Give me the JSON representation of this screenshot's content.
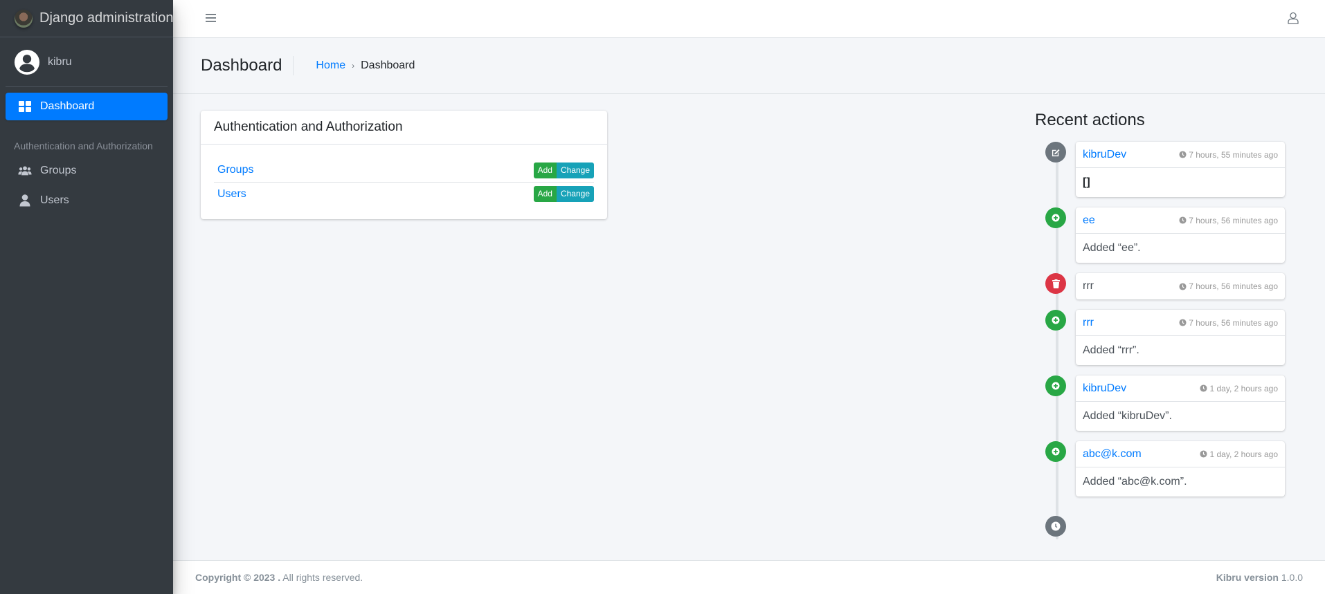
{
  "brand": {
    "title": "Django administration"
  },
  "user": {
    "name": "kibru"
  },
  "sidebar": {
    "dashboard_label": "Dashboard",
    "section_header": "Authentication and Authorization",
    "items": [
      {
        "label": "Groups",
        "icon": "users-icon"
      },
      {
        "label": "Users",
        "icon": "user-icon"
      }
    ]
  },
  "content_header": {
    "title": "Dashboard",
    "breadcrumb": {
      "home": "Home",
      "separator": "›",
      "current": "Dashboard"
    }
  },
  "app_card": {
    "title": "Authentication and Authorization",
    "models": [
      {
        "name": "Groups",
        "add": "Add",
        "change": "Change"
      },
      {
        "name": "Users",
        "add": "Add",
        "change": "Change"
      }
    ]
  },
  "recent_actions": {
    "title": "Recent actions",
    "items": [
      {
        "type": "change",
        "name": "kibruDev",
        "time": "7 hours, 55 minutes ago",
        "body": "[]"
      },
      {
        "type": "add",
        "name": "ee",
        "time": "7 hours, 56 minutes ago",
        "body": "Added “ee”."
      },
      {
        "type": "delete",
        "name": "rrr",
        "time": "7 hours, 56 minutes ago",
        "body": null
      },
      {
        "type": "add",
        "name": "rrr",
        "time": "7 hours, 56 minutes ago",
        "body": "Added “rrr”."
      },
      {
        "type": "add",
        "name": "kibruDev",
        "time": "1 day, 2 hours ago",
        "body": "Added “kibruDev”."
      },
      {
        "type": "add",
        "name": "abc@k.com",
        "time": "1 day, 2 hours ago",
        "body": "Added “abc@k.com”."
      }
    ]
  },
  "footer": {
    "copyright_bold": "Copyright © 2023 .",
    "copyright_rest": " All rights reserved.",
    "version_label": "Kibru version",
    "version_number": " 1.0.0"
  },
  "colors": {
    "primary": "#007bff",
    "success": "#28a745",
    "info": "#17a2b8",
    "danger": "#dc3545",
    "secondary": "#6c757d",
    "sidebar_bg": "#343a40",
    "content_bg": "#f4f6f9"
  }
}
